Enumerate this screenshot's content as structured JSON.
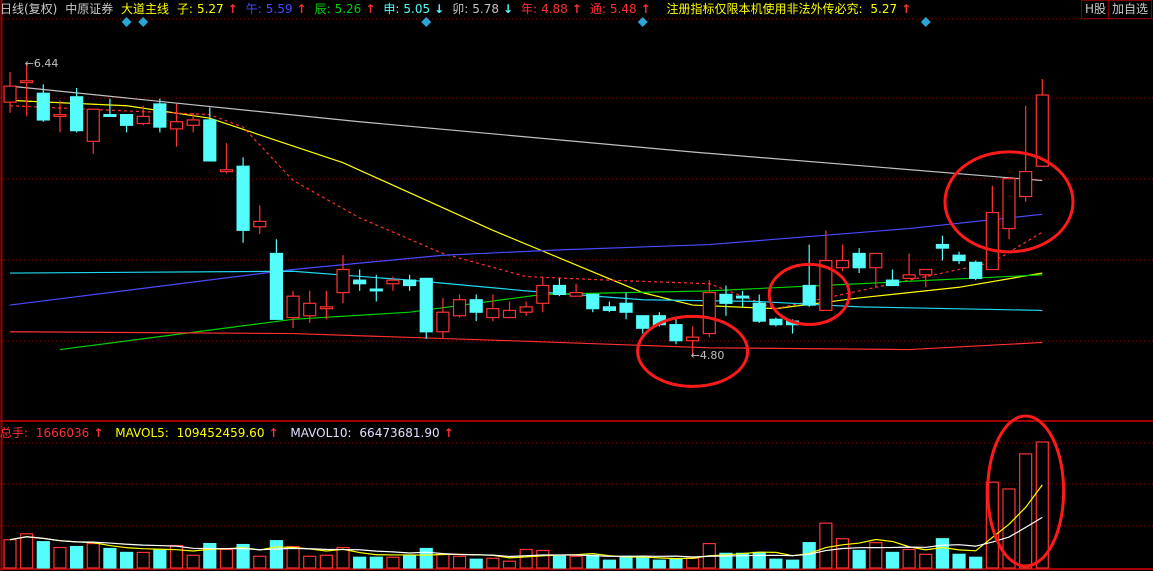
{
  "header": {
    "period": "日线(复权)",
    "stock_name": "中原证券",
    "indicator_name": "大道主线",
    "items": [
      {
        "label": "子:",
        "value": "5.27",
        "color": "#ffff00",
        "dir": "up"
      },
      {
        "label": "午:",
        "value": "5.59",
        "color": "#4a4aff",
        "dir": "up"
      },
      {
        "label": "辰:",
        "value": "5.26",
        "color": "#00d000",
        "dir": "up"
      },
      {
        "label": "申:",
        "value": "5.05",
        "color": "#54fcfc",
        "dir": "down"
      },
      {
        "label": "卯:",
        "value": "5.78",
        "color": "#c0c0c0",
        "dir": "down"
      },
      {
        "label": "年:",
        "value": "4.88",
        "color": "#ff3030",
        "dir": "up"
      },
      {
        "label": "通:",
        "value": "5.48",
        "color": "#ff3030",
        "dir": "up"
      }
    ],
    "notice": "注册指标仅限本机使用非法外传必究:",
    "notice_value": "5.27",
    "arrow_up": "↑",
    "arrow_down": "↓"
  },
  "buttons": {
    "h_share": "H股",
    "add_watch": "加自选"
  },
  "volume_header": {
    "total_label": "总手:",
    "total_value": "1666036",
    "mavol5_label": "MAVOL5:",
    "mavol5_value": "109452459.60",
    "mavol10_label": "MAVOL10:",
    "mavol10_value": "66473681.90"
  },
  "colors": {
    "up": "#ff3232",
    "down": "#54fcfc",
    "grid": "#8b0000",
    "marker": "#2aa6d6"
  },
  "chart_data": {
    "type": "candlestick",
    "price_labels": {
      "high": "6.44",
      "low": "4.80",
      "arrow": "←"
    },
    "ylim": [
      4.75,
      6.6
    ],
    "candles": [
      [
        6.22,
        6.31,
        6.39,
        6.16
      ],
      [
        6.33,
        6.34,
        6.44,
        6.14
      ],
      [
        6.27,
        6.12,
        6.32,
        6.11
      ],
      [
        6.14,
        6.15,
        6.23,
        6.05
      ],
      [
        6.25,
        6.06,
        6.3,
        6.05
      ],
      [
        6.0,
        6.18,
        6.18,
        5.93
      ],
      [
        6.15,
        6.14,
        6.24,
        6.14
      ],
      [
        6.15,
        6.09,
        6.15,
        6.05
      ],
      [
        6.1,
        6.14,
        6.2,
        6.09
      ],
      [
        6.21,
        6.08,
        6.24,
        6.05
      ],
      [
        6.07,
        6.11,
        6.21,
        5.97
      ],
      [
        6.09,
        6.12,
        6.16,
        6.05
      ],
      [
        6.12,
        5.89,
        6.19,
        5.89
      ],
      [
        5.83,
        5.84,
        5.99,
        5.82
      ],
      [
        5.86,
        5.5,
        5.91,
        5.43
      ],
      [
        5.52,
        5.55,
        5.64,
        5.48
      ],
      [
        5.37,
        5.0,
        5.45,
        5.0
      ],
      [
        5.01,
        5.13,
        5.16,
        4.95
      ],
      [
        5.02,
        5.09,
        5.16,
        4.98
      ],
      [
        5.06,
        5.07,
        5.16,
        5.0
      ],
      [
        5.15,
        5.28,
        5.36,
        5.09
      ],
      [
        5.22,
        5.2,
        5.28,
        5.16
      ],
      [
        5.17,
        5.16,
        5.25,
        5.1
      ],
      [
        5.2,
        5.22,
        5.24,
        5.16
      ],
      [
        5.22,
        5.19,
        5.25,
        5.16
      ],
      [
        5.23,
        4.93,
        5.23,
        4.89
      ],
      [
        4.93,
        5.04,
        5.12,
        4.89
      ],
      [
        5.02,
        5.11,
        5.14,
        5.01
      ],
      [
        5.11,
        5.04,
        5.14,
        4.99
      ],
      [
        5.01,
        5.06,
        5.14,
        4.99
      ],
      [
        5.01,
        5.05,
        5.1,
        5.01
      ],
      [
        5.04,
        5.07,
        5.1,
        5.02
      ],
      [
        5.09,
        5.19,
        5.24,
        5.04
      ],
      [
        5.19,
        5.14,
        5.23,
        5.13
      ],
      [
        5.13,
        5.15,
        5.2,
        5.13
      ],
      [
        5.14,
        5.06,
        5.14,
        5.04
      ],
      [
        5.07,
        5.05,
        5.1,
        5.04
      ],
      [
        5.09,
        5.04,
        5.15,
        5.0
      ],
      [
        5.02,
        4.95,
        5.02,
        4.92
      ],
      [
        5.02,
        4.97,
        5.04,
        4.96
      ],
      [
        4.97,
        4.88,
        5.01,
        4.86
      ],
      [
        4.88,
        4.9,
        4.96,
        4.8
      ],
      [
        4.92,
        5.15,
        5.22,
        4.9
      ],
      [
        5.14,
        5.09,
        5.19,
        5.02
      ],
      [
        5.13,
        5.12,
        5.16,
        5.07
      ],
      [
        5.09,
        4.99,
        5.14,
        4.98
      ],
      [
        5.0,
        4.97,
        5.01,
        4.96
      ],
      [
        4.99,
        4.97,
        5.0,
        4.92
      ],
      [
        5.19,
        5.08,
        5.42,
        5.07
      ],
      [
        5.05,
        5.33,
        5.5,
        5.05
      ],
      [
        5.29,
        5.33,
        5.42,
        5.27
      ],
      [
        5.37,
        5.29,
        5.4,
        5.26
      ],
      [
        5.29,
        5.37,
        5.37,
        5.18
      ],
      [
        5.22,
        5.19,
        5.28,
        5.19
      ],
      [
        5.23,
        5.25,
        5.37,
        5.23
      ],
      [
        5.25,
        5.28,
        5.28,
        5.18
      ],
      [
        5.42,
        5.4,
        5.47,
        5.33
      ],
      [
        5.36,
        5.33,
        5.38,
        5.31
      ],
      [
        5.32,
        5.23,
        5.33,
        5.22
      ],
      [
        5.28,
        5.6,
        5.75,
        5.28
      ],
      [
        5.51,
        5.79,
        5.8,
        5.45
      ],
      [
        5.69,
        5.83,
        6.2,
        5.66
      ],
      [
        5.86,
        6.26,
        6.35,
        5.86
      ]
    ],
    "candle_fields": [
      "open",
      "close",
      "high",
      "low"
    ],
    "ma_lines": [
      {
        "name": "卯",
        "color": "#c0c0c0",
        "dashed": false,
        "points": [
          [
            0,
            6.31
          ],
          [
            21,
            6.11
          ],
          [
            41,
            5.94
          ],
          [
            62,
            5.78
          ]
        ]
      },
      {
        "name": "子",
        "color": "#ffff00",
        "dashed": false,
        "points": [
          [
            0,
            6.23
          ],
          [
            7,
            6.2
          ],
          [
            12,
            6.13
          ],
          [
            20,
            5.88
          ],
          [
            29,
            5.5
          ],
          [
            38,
            5.15
          ],
          [
            41,
            5.08
          ],
          [
            46,
            5.06
          ],
          [
            51,
            5.12
          ],
          [
            57,
            5.18
          ],
          [
            62,
            5.26
          ]
        ]
      },
      {
        "name": "通",
        "color": "#ff3030",
        "dashed": true,
        "points": [
          [
            0,
            6.2
          ],
          [
            12,
            6.15
          ],
          [
            14,
            6.08
          ],
          [
            17,
            5.78
          ],
          [
            21,
            5.57
          ],
          [
            26,
            5.37
          ],
          [
            31,
            5.24
          ],
          [
            36,
            5.22
          ],
          [
            42,
            5.2
          ],
          [
            46,
            5.06
          ],
          [
            50,
            5.14
          ],
          [
            54,
            5.22
          ],
          [
            59,
            5.32
          ],
          [
            62,
            5.49
          ]
        ]
      },
      {
        "name": "午",
        "color": "#4a4aff",
        "dashed": false,
        "points": [
          [
            0,
            5.08
          ],
          [
            17,
            5.28
          ],
          [
            26,
            5.36
          ],
          [
            33,
            5.39
          ],
          [
            42,
            5.42
          ],
          [
            54,
            5.51
          ],
          [
            62,
            5.59
          ]
        ]
      },
      {
        "name": "申",
        "color": "#20d8f0",
        "dashed": false,
        "points": [
          [
            0,
            5.26
          ],
          [
            17,
            5.27
          ],
          [
            24,
            5.22
          ],
          [
            31,
            5.16
          ],
          [
            38,
            5.11
          ],
          [
            45,
            5.1
          ],
          [
            51,
            5.07
          ],
          [
            62,
            5.05
          ]
        ]
      },
      {
        "name": "辰",
        "color": "#00d000",
        "dashed": false,
        "points": [
          [
            3,
            4.83
          ],
          [
            17,
            5.0
          ],
          [
            24,
            5.04
          ],
          [
            32,
            5.14
          ],
          [
            42,
            5.16
          ],
          [
            51,
            5.2
          ],
          [
            62,
            5.25
          ]
        ]
      },
      {
        "name": "年",
        "color": "#ff3030",
        "dashed": false,
        "points": [
          [
            0,
            4.93
          ],
          [
            17,
            4.92
          ],
          [
            30,
            4.88
          ],
          [
            42,
            4.84
          ],
          [
            54,
            4.83
          ],
          [
            62,
            4.87
          ]
        ]
      }
    ],
    "volumes": [
      374000,
      452000,
      348000,
      271000,
      284000,
      323000,
      258000,
      206000,
      206000,
      245000,
      297000,
      168000,
      323000,
      245000,
      310000,
      155000,
      361000,
      284000,
      155000,
      168000,
      271000,
      142000,
      142000,
      142000,
      168000,
      258000,
      181000,
      155000,
      116000,
      129000,
      90000,
      245000,
      232000,
      155000,
      155000,
      168000,
      103000,
      155000,
      142000,
      103000,
      116000,
      129000,
      323000,
      194000,
      194000,
      206000,
      116000,
      103000,
      335000,
      593000,
      387000,
      232000,
      335000,
      206000,
      245000,
      181000,
      387000,
      181000,
      142000,
      1135000,
      1045000,
      1509000,
      1666036
    ],
    "signal_markers": [
      7,
      8,
      25,
      38,
      55
    ],
    "highlight_circles": [
      [
        41,
        4.82
      ],
      [
        48,
        5.14
      ],
      [
        60,
        5.66
      ]
    ]
  }
}
